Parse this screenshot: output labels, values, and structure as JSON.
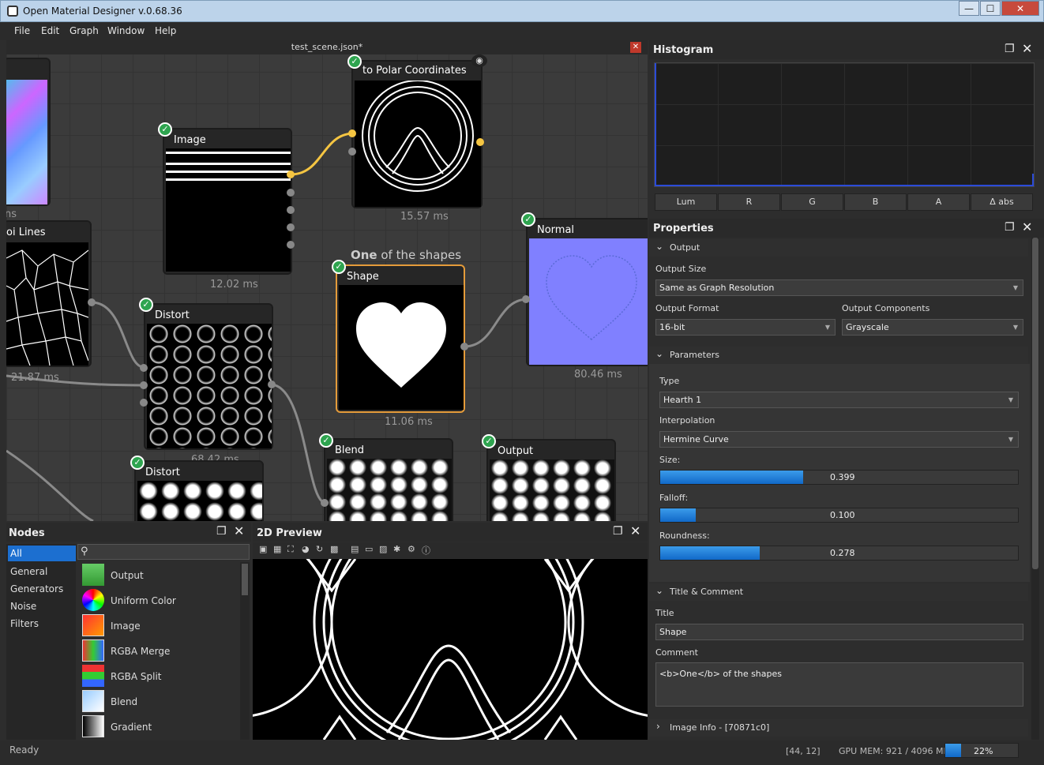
{
  "window": {
    "title": "Open Material Designer v.0.68.36",
    "minimize": "—",
    "maximize": "☐",
    "close": "✕"
  },
  "menu": {
    "file": "File",
    "edit": "Edit",
    "graph": "Graph",
    "window": "Window",
    "help": "Help"
  },
  "graph": {
    "tab_title": "test_scene.json*",
    "close_glyph": "✕",
    "comment_bold": "One",
    "comment_rest": " of the shapes",
    "nodes": {
      "voronoi": {
        "label": "oi Lines",
        "time": "21.87 ms",
        "partial_label": "ns"
      },
      "image": {
        "label": "Image",
        "time": "12.02 ms"
      },
      "polar": {
        "label": "to Polar Coordinates",
        "time": "15.57 ms"
      },
      "distort1": {
        "label": "Distort",
        "time": "68.42 ms"
      },
      "distort2": {
        "label": "Distort"
      },
      "shape": {
        "label": "Shape",
        "time": "11.06 ms"
      },
      "normal": {
        "label": "Normal",
        "time": "80.46 ms"
      },
      "blend": {
        "label": "Blend"
      },
      "output": {
        "label": "Output"
      }
    }
  },
  "histogram": {
    "title": "Histogram",
    "buttons": [
      "Lum",
      "R",
      "G",
      "B",
      "A",
      "Δ abs"
    ]
  },
  "properties": {
    "title": "Properties",
    "output_section": "Output",
    "output_size_label": "Output Size",
    "output_size_value": "Same as Graph Resolution",
    "output_format_label": "Output Format",
    "output_format_value": "16-bit",
    "output_components_label": "Output Components",
    "output_components_value": "Grayscale",
    "parameters_section": "Parameters",
    "type_label": "Type",
    "type_value": "Hearth 1",
    "interp_label": "Interpolation",
    "interp_value": "Hermine Curve",
    "size_label": "Size:",
    "size_value": "0.399",
    "size_fill": 0.399,
    "falloff_label": "Falloff:",
    "falloff_value": "0.100",
    "falloff_fill": 0.1,
    "roundness_label": "Roundness:",
    "roundness_value": "0.278",
    "roundness_fill": 0.278,
    "title_section": "Title & Comment",
    "title_label": "Title",
    "title_value": "Shape",
    "comment_label": "Comment",
    "comment_value": "<b>One</b> of the shapes",
    "image_info": "Image Info - [70871c0]"
  },
  "nodes_panel": {
    "title": "Nodes",
    "categories": [
      "All",
      "General",
      "Generators",
      "Noise",
      "Filters"
    ],
    "items": [
      "Output",
      "Uniform Color",
      "Image",
      "RGBA Merge",
      "RGBA Split",
      "Blend",
      "Gradient"
    ],
    "search_placeholder": ""
  },
  "preview": {
    "title": "2D Preview"
  },
  "status": {
    "ready": "Ready",
    "coords": "[44, 12]",
    "gpu": "GPU MEM: 921 / 4096 MB",
    "gpu_pct": "22%",
    "gpu_fill": 0.22
  }
}
